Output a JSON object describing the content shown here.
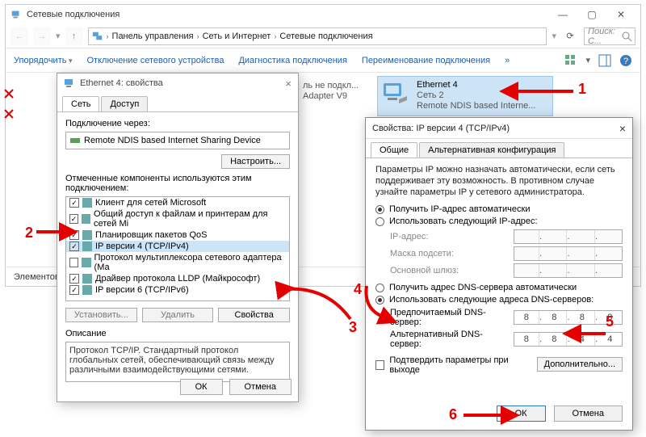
{
  "main": {
    "title": "Сетевые подключения",
    "breadcrumb": [
      "Панель управления",
      "Сеть и Интернет",
      "Сетевые подключения"
    ],
    "search_placeholder": "Поиск: С...",
    "toolbar": {
      "organize": "Упорядочить",
      "disable": "Отключение сетевого устройства",
      "diagnose": "Диагностика подключения",
      "rename": "Переименование подключения",
      "more": "»"
    },
    "conn_partial": {
      "l2": "ль не подкл...",
      "l3": "Adapter V9"
    },
    "conn_sel": {
      "l1": "Ethernet 4",
      "l2": "Сеть 2",
      "l3": "Remote NDIS based Interne..."
    },
    "status": "Элементов"
  },
  "dlg1": {
    "title": "Ethernet 4: свойства",
    "tabs": {
      "net": "Сеть",
      "access": "Доступ"
    },
    "connect_via": "Подключение через:",
    "device": "Remote NDIS based Internet Sharing Device",
    "configure": "Настроить...",
    "components_label": "Отмеченные компоненты используются этим подключением:",
    "components": [
      {
        "checked": true,
        "label": "Клиент для сетей Microsoft"
      },
      {
        "checked": true,
        "label": "Общий доступ к файлам и принтерам для сетей Mi"
      },
      {
        "checked": true,
        "label": "Планировщик пакетов QoS"
      },
      {
        "checked": true,
        "label": "IP версии 4 (TCP/IPv4)",
        "selected": true
      },
      {
        "checked": false,
        "label": "Протокол мультиплексора сетевого адаптера (Ма"
      },
      {
        "checked": true,
        "label": "Драйвер протокола LLDP (Майкрософт)"
      },
      {
        "checked": true,
        "label": "IP версии 6 (TCP/IPv6)"
      }
    ],
    "btn_install": "Установить...",
    "btn_remove": "Удалить",
    "btn_props": "Свойства",
    "desc_label": "Описание",
    "desc_text": "Протокол TCP/IP. Стандартный протокол глобальных сетей, обеспечивающий связь между различными взаимодействующими сетями.",
    "ok": "ОК",
    "cancel": "Отмена"
  },
  "dlg2": {
    "title": "Свойства: IP версии 4 (TCP/IPv4)",
    "tab_general": "Общие",
    "tab_alt": "Альтернативная конфигурация",
    "info": "Параметры IP можно назначать автоматически, если сеть поддерживает эту возможность. В противном случае узнайте параметры IP у сетевого администратора.",
    "r_ip_auto": "Получить IP-адрес автоматически",
    "r_ip_manual": "Использовать следующий IP-адрес:",
    "f_ip": "IP-адрес:",
    "f_mask": "Маска подсети:",
    "f_gw": "Основной шлюз:",
    "r_dns_auto": "Получить адрес DNS-сервера автоматически",
    "r_dns_manual": "Использовать следующие адреса DNS-серверов:",
    "f_dns1": "Предпочитаемый DNS-сервер:",
    "f_dns2": "Альтернативный DNS-сервер:",
    "dns1": [
      "8",
      "8",
      "8",
      "8"
    ],
    "dns2": [
      "8",
      "8",
      "4",
      "4"
    ],
    "chk_validate": "Подтвердить параметры при выходе",
    "advanced": "Дополнительно...",
    "ok": "ОК",
    "cancel": "Отмена"
  },
  "ann": {
    "n1": "1",
    "n2": "2",
    "n3": "3",
    "n4": "4",
    "n5": "5",
    "n6": "6"
  }
}
